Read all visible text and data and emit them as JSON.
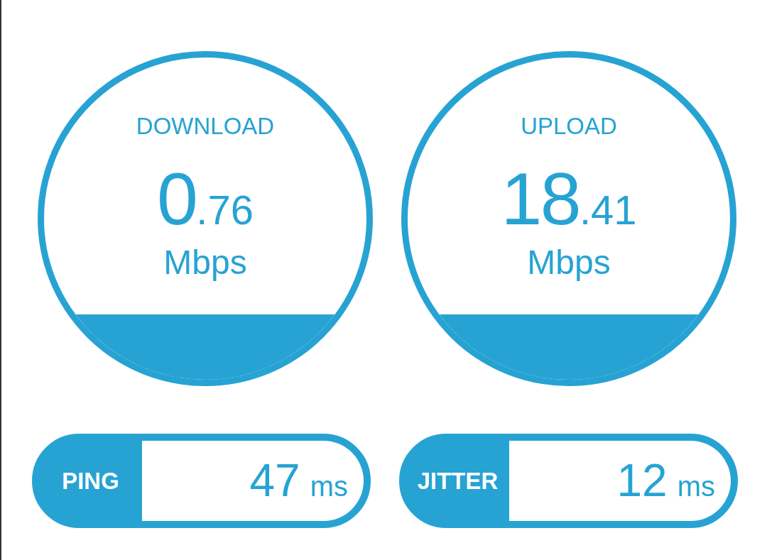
{
  "results": [
    {
      "label": "DOWNLOAD",
      "value_whole": "0",
      "value_fraction": ".76",
      "unit": "Mbps"
    },
    {
      "label": "UPLOAD",
      "value_whole": "18",
      "value_fraction": ".41",
      "unit": "Mbps"
    }
  ],
  "latency": [
    {
      "label": "PING",
      "value": "47",
      "unit": "ms"
    },
    {
      "label": "JITTER",
      "value": "12",
      "unit": "ms"
    }
  ]
}
